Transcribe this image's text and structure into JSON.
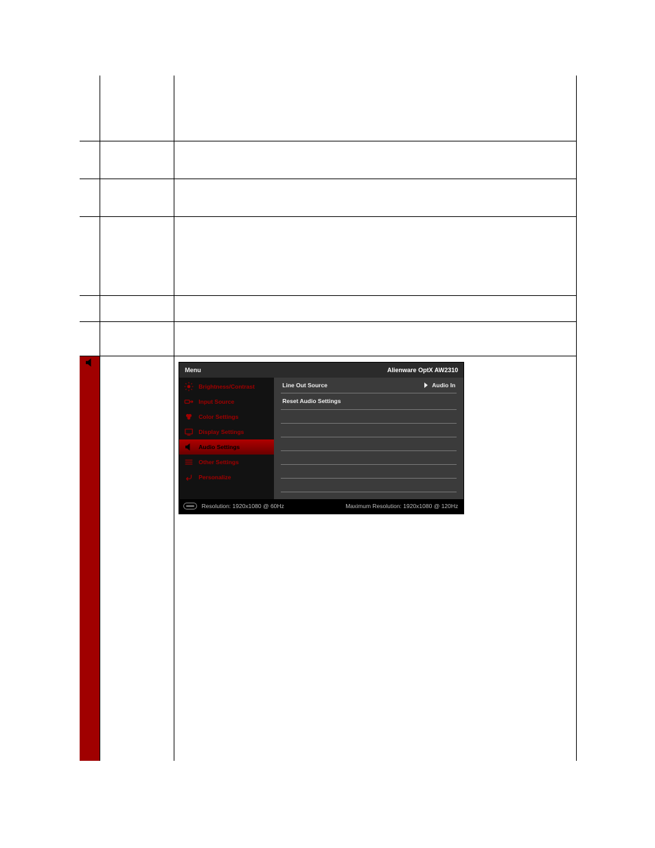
{
  "osd": {
    "header": {
      "menu_label": "Menu",
      "model_prefix": "Alienware OptX ",
      "model_bold": "AW2310"
    },
    "sidebar": {
      "items": [
        {
          "label": "Brightness/Contrast"
        },
        {
          "label": "Input Source"
        },
        {
          "label": "Color Settings"
        },
        {
          "label": "Display Settings"
        },
        {
          "label": "Audio Settings"
        },
        {
          "label": "Other Settings"
        },
        {
          "label": "Personalize"
        }
      ],
      "selected_index": 4
    },
    "options": [
      {
        "label": "Line Out Source",
        "value": "Audio In"
      },
      {
        "label": "Reset Audio Settings",
        "value": ""
      }
    ],
    "footer": {
      "res_label": "Resolution: 1920x1080 @ 60Hz",
      "max_res_label": "Maximum Resolution: 1920x1080 @ 120Hz"
    }
  }
}
